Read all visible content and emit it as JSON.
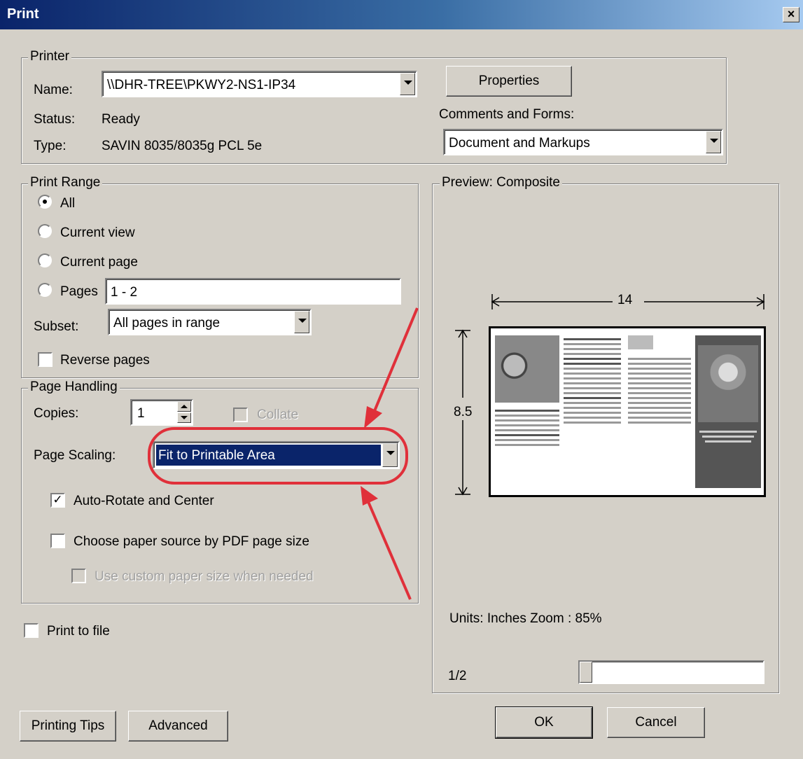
{
  "window": {
    "title": "Print"
  },
  "printer": {
    "group_label": "Printer",
    "name_label": "Name:",
    "name_value": "\\\\DHR-TREE\\PKWY2-NS1-IP34",
    "status_label": "Status:",
    "status_value": "Ready",
    "type_label": "Type:",
    "type_value": "SAVIN 8035/8035g PCL 5e",
    "properties_button": "Properties",
    "comments_label": "Comments and Forms:",
    "comments_value": "Document and Markups"
  },
  "print_range": {
    "group_label": "Print Range",
    "options": [
      {
        "label": "All",
        "selected": true
      },
      {
        "label": "Current view",
        "selected": false
      },
      {
        "label": "Current page",
        "selected": false
      },
      {
        "label": "Pages",
        "selected": false
      }
    ],
    "pages_value": "1 - 2",
    "subset_label": "Subset:",
    "subset_value": "All pages in range",
    "reverse_label": "Reverse pages",
    "reverse_checked": false
  },
  "page_handling": {
    "group_label": "Page Handling",
    "copies_label": "Copies:",
    "copies_value": "1",
    "collate_label": "Collate",
    "scaling_label": "Page Scaling:",
    "scaling_value": "Fit to Printable Area",
    "auto_rotate_label": "Auto-Rotate and Center",
    "auto_rotate_checked": true,
    "paper_source_label": "Choose paper source by PDF page size",
    "custom_paper_label": "Use custom paper size when needed"
  },
  "print_to_file_label": "Print to file",
  "preview": {
    "group_label": "Preview: Composite",
    "width_label": "14",
    "height_label": "8.5",
    "units_zoom": "Units: Inches Zoom :  85%",
    "page_indicator": "1/2",
    "page_position": 0.0
  },
  "buttons": {
    "printing_tips": "Printing Tips",
    "advanced": "Advanced",
    "ok": "OK",
    "cancel": "Cancel"
  },
  "colors": {
    "annotation": "#e0303a",
    "title_bar": "#0a246a",
    "selection": "#0a246a"
  }
}
